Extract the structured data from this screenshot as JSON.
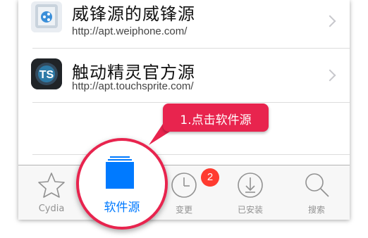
{
  "rows": [
    {
      "title": "威锋源的威锋源",
      "url": "http://apt.weiphone.com/"
    },
    {
      "title": "触动精灵官方源",
      "url": "http://apt.touchsprite.com/",
      "icon_text": "TS"
    }
  ],
  "tabs": [
    {
      "id": "cydia",
      "label": "Cydia",
      "icon": "star-icon"
    },
    {
      "id": "sources",
      "label": "软件源",
      "icon": "sources-icon",
      "selected": true
    },
    {
      "id": "changes",
      "label": "变更",
      "icon": "clock-icon",
      "badge": "2"
    },
    {
      "id": "installed",
      "label": "已安装",
      "icon": "download-icon"
    },
    {
      "id": "search",
      "label": "搜索",
      "icon": "search-icon"
    }
  ],
  "callout": {
    "text": "1.点击软件源"
  },
  "colors": {
    "accent": "#007aff",
    "highlight": "#e8244e",
    "badge": "#ff3b30"
  }
}
